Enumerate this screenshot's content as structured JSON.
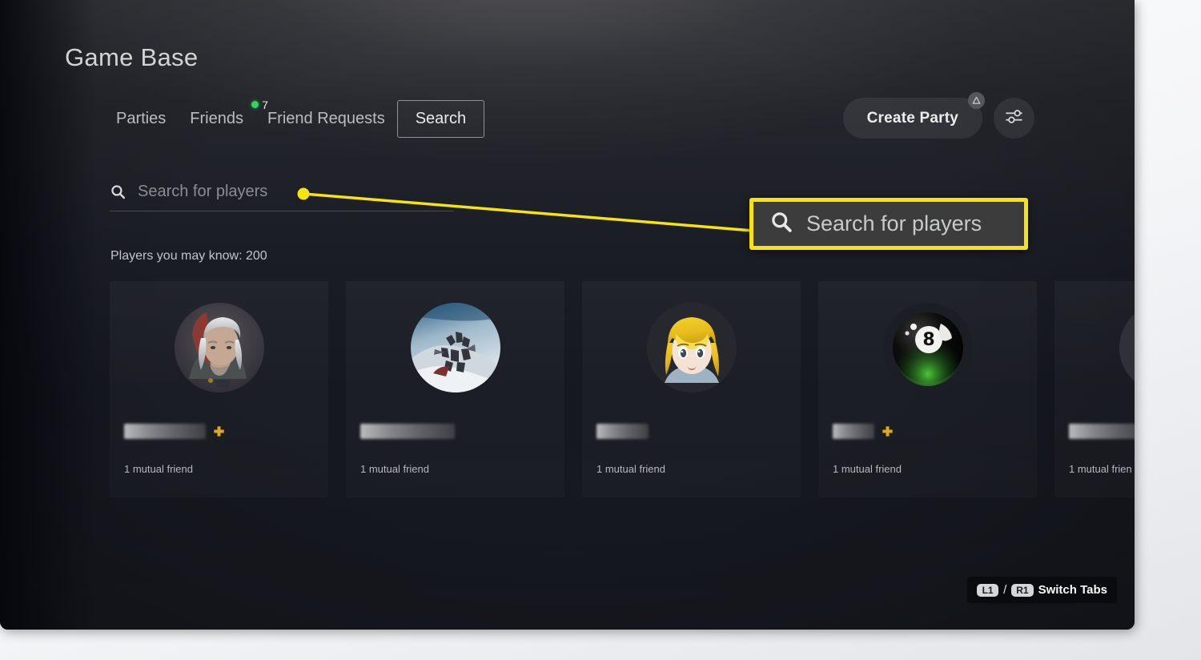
{
  "panel": {
    "title": "Game Base"
  },
  "tabs": [
    {
      "label": "Parties",
      "selected": false
    },
    {
      "label": "Friends",
      "selected": false,
      "badge_count": "7",
      "badge_color": "#36d35e"
    },
    {
      "label": "Friend Requests",
      "selected": false
    },
    {
      "label": "Search",
      "selected": true
    }
  ],
  "header_actions": {
    "create_party_label": "Create Party",
    "create_party_icon": "playstation-triangle-icon",
    "filter_icon": "sliders-icon"
  },
  "search": {
    "icon": "search-icon",
    "placeholder": "Search for players",
    "value": ""
  },
  "section": {
    "label": "Players you may know: 200",
    "count": 200
  },
  "cards": [
    {
      "avatar": "witcher-geralt-avatar",
      "name_masked": true,
      "name_width": 102,
      "has_plus_badge": true,
      "mutual": "1 mutual friend"
    },
    {
      "avatar": "destiny-squad-avatar",
      "name_masked": true,
      "name_width": 118,
      "has_plus_badge": false,
      "mutual": "1 mutual friend"
    },
    {
      "avatar": "anime-blonde-avatar",
      "name_masked": true,
      "name_width": 65,
      "has_plus_badge": false,
      "mutual": "1 mutual friend"
    },
    {
      "avatar": "eight-ball-avatar",
      "name_masked": true,
      "name_width": 52,
      "has_plus_badge": true,
      "mutual": "1 mutual friend"
    },
    {
      "avatar": "generic-avatar",
      "name_masked": true,
      "name_width": 95,
      "has_plus_badge": false,
      "mutual": "1 mutual frien"
    }
  ],
  "hint": {
    "key_left": "L1",
    "separator": "/",
    "key_right": "R1",
    "label": "Switch Tabs"
  },
  "annotation": {
    "callout_text": "Search for players",
    "callout_icon": "search-icon",
    "color": "#f6e310"
  }
}
